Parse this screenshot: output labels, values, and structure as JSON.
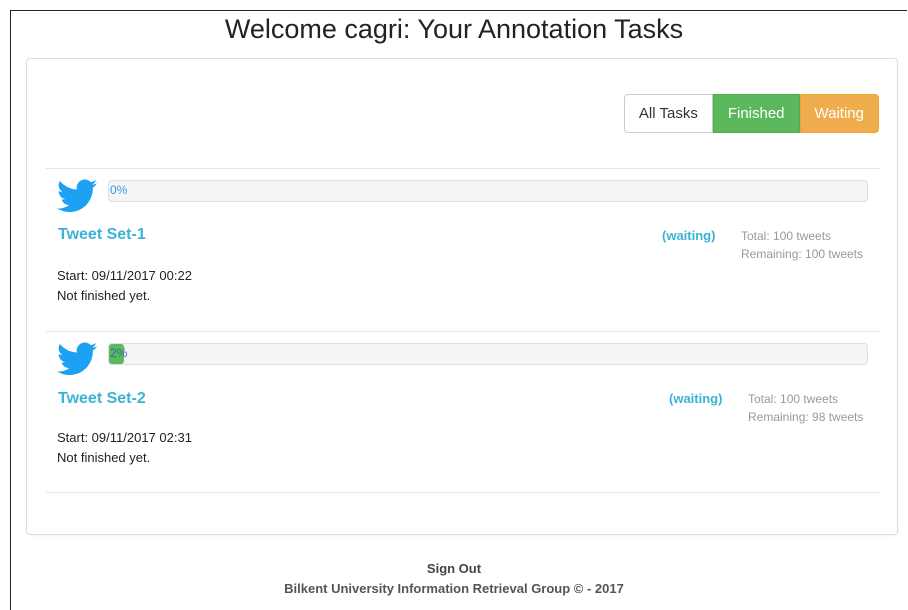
{
  "header": {
    "title": "Welcome cagri: Your Annotation Tasks"
  },
  "filters": {
    "all": "All Tasks",
    "finished": "Finished",
    "waiting": "Waiting"
  },
  "colors": {
    "accent": "#3ab3d6",
    "finished": "#5cb85c",
    "waiting": "#f0ad4e",
    "twitter": "#1da1f2"
  },
  "tasks": [
    {
      "icon": "twitter-bird-icon",
      "progress": 0,
      "progress_label": "0%",
      "name": "Tweet Set-1",
      "status": "(waiting)",
      "total": "Total: 100 tweets",
      "remaining": "Remaining: 100 tweets",
      "start": "Start: 09/11/2017 00:22",
      "finish": "Not finished yet."
    },
    {
      "icon": "twitter-bird-icon",
      "progress": 2,
      "progress_label": "2%",
      "name": "Tweet Set-2",
      "status": "(waiting)",
      "total": "Total: 100 tweets",
      "remaining": "Remaining: 98 tweets",
      "start": "Start: 09/11/2017 02:31",
      "finish": "Not finished yet."
    }
  ],
  "footer": {
    "signout": "Sign Out",
    "credit": "Bilkent University Information Retrieval Group © - 2017"
  }
}
